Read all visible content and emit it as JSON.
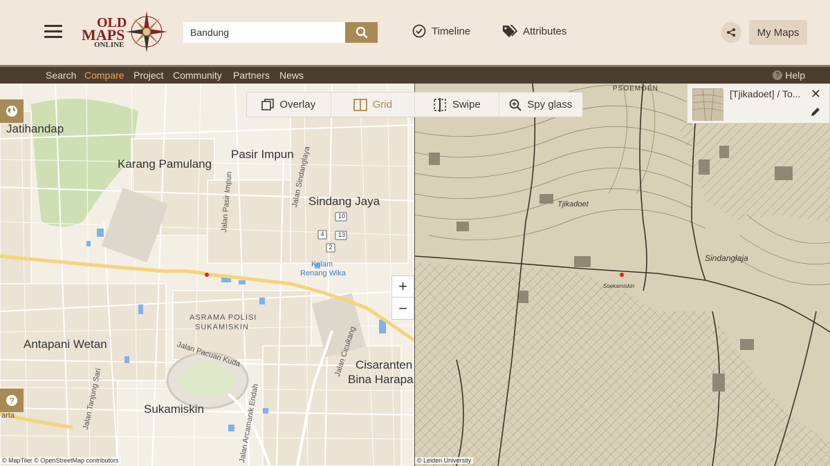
{
  "header": {
    "logo": {
      "line1": "OLD",
      "line2": "MAPS",
      "line3": "ONLINE"
    },
    "search": {
      "value": "Bandung",
      "placeholder": "Search"
    },
    "timeline_label": "Timeline",
    "attributes_label": "Attributes",
    "mymaps_label": "My Maps"
  },
  "nav": {
    "items": [
      {
        "label": "Search"
      },
      {
        "label": "Compare"
      },
      {
        "label": "Project"
      },
      {
        "label": "Community"
      },
      {
        "label": "Partners"
      },
      {
        "label": "News"
      }
    ],
    "active": "Compare",
    "help_label": "Help"
  },
  "compare_toolbar": {
    "tools": [
      {
        "label": "Overlay",
        "icon": "overlay-icon"
      },
      {
        "label": "Grid",
        "icon": "grid-icon"
      },
      {
        "label": "Swipe",
        "icon": "swipe-icon"
      },
      {
        "label": "Spy glass",
        "icon": "spyglass-icon"
      }
    ],
    "active": "Grid"
  },
  "left_map": {
    "labels": {
      "jatihandap": "Jatihandap",
      "karang_pamulang": "Karang Pamulang",
      "pasir_impun": "Pasir Impun",
      "sindang_jaya": "Sindang Jaya",
      "antapani_wetan": "Antapani Wetan",
      "sukamiskin": "Sukamiskin",
      "cisaranten": "Cisaranten",
      "bina_harapa": "Bina Harapa",
      "asrama_1": "ASRAMA POLISI",
      "asrama_2": "SUKAMISKIN",
      "kolam_1": "Kolam",
      "kolam_2": "Renang Wika",
      "jalan_pacuan_kuda": "Jalan Pacuan Kuda",
      "jalan_pasir_impun": "Jalan Pasir Impun",
      "jalan_sindanglaya": "Jalan Sindanglaya",
      "jalan_cicukang": "Jalan Cicukang",
      "jalan_tanjung_sari": "Jalan Tanjung Sari",
      "jalan_arcamanik": "Jalan Arcamanik Endah",
      "arta": "arta"
    },
    "route_shields": [
      "10",
      "13",
      "4",
      "2"
    ],
    "attribution": "© MapTiler © OpenStreetMap contributors"
  },
  "right_map": {
    "labels": {
      "psoemoen": "PSOEMOEN",
      "tjikadoet": "Tjikadoet",
      "sindanglaja": "Sindanglaja",
      "soekamiskin": "Soekamiskin"
    },
    "attribution": "© Leiden University"
  },
  "map_card": {
    "title": "[Tjikadoet] / To..."
  },
  "colors": {
    "accent": "#a88a55",
    "nav_bg": "#4b3d30",
    "active_nav": "#f0a54a",
    "header_bg": "#f1e7db"
  }
}
